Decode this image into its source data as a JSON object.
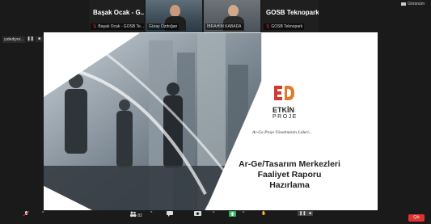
{
  "view_button": "Görünüm",
  "tiles": [
    {
      "big": "Başak Ocak - G...",
      "label": "Başak Ocak - GOSB Te...",
      "muted": true
    },
    {
      "big": "",
      "label": "Güray Özdoğan",
      "muted": false
    },
    {
      "big": "",
      "label": "İBRAHİM KABADA",
      "muted": false
    },
    {
      "big": "GOSB Teknopark",
      "label": "GOSB Teknopark",
      "muted": true
    }
  ],
  "share_bar": {
    "text": "yıdediyor..."
  },
  "slide": {
    "logo_line1": "ETKİN",
    "logo_line2": "PROJE",
    "tagline": "Ar-Ge Proje Yönetiminin Lideri...",
    "title_lines": [
      "Ar-Ge/Tasarım Merkezleri",
      "Faaliyet Raporu",
      "Hazırlama"
    ]
  },
  "toolbar": {
    "participants_count": "82",
    "leave": "Çık"
  },
  "colors": {
    "accent_red": "#d33a2f",
    "dark_bg": "#1a1a1a"
  }
}
